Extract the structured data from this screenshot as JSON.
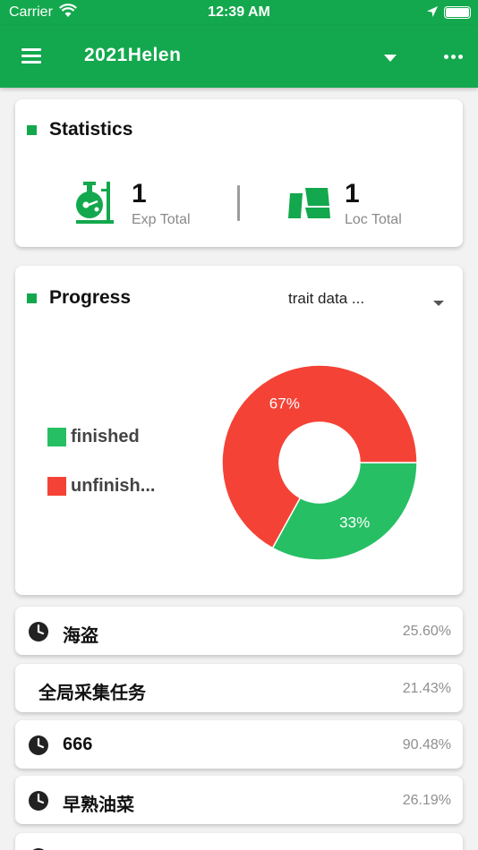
{
  "status_bar": {
    "carrier": "Carrier",
    "time": "12:39 AM"
  },
  "app_bar": {
    "title": "2021Helen"
  },
  "statistics": {
    "title": "Statistics",
    "exp": {
      "value": "1",
      "label": "Exp Total"
    },
    "loc": {
      "value": "1",
      "label": "Loc Total"
    }
  },
  "progress": {
    "title": "Progress",
    "selector": "trait data ...",
    "legend": [
      {
        "label": "finished",
        "color": "#27bf64"
      },
      {
        "label": "unfinish...",
        "color": "#f44336"
      }
    ]
  },
  "chart_data": {
    "type": "pie",
    "donut": true,
    "categories": [
      "finished",
      "unfinish..."
    ],
    "values": [
      33,
      67
    ],
    "labels": [
      "33%",
      "67%"
    ],
    "colors": [
      "#27bf64",
      "#f44336"
    ],
    "legend": "left"
  },
  "tasks": [
    {
      "name": "海盗",
      "percent": "25.60%",
      "icon": "clock-icon"
    },
    {
      "name": "全局采集任务",
      "percent": "21.43%",
      "icon": ""
    },
    {
      "name": "666",
      "percent": "90.48%",
      "icon": "clock-icon"
    },
    {
      "name": "早熟油菜",
      "percent": "26.19%",
      "icon": "clock-icon"
    }
  ]
}
